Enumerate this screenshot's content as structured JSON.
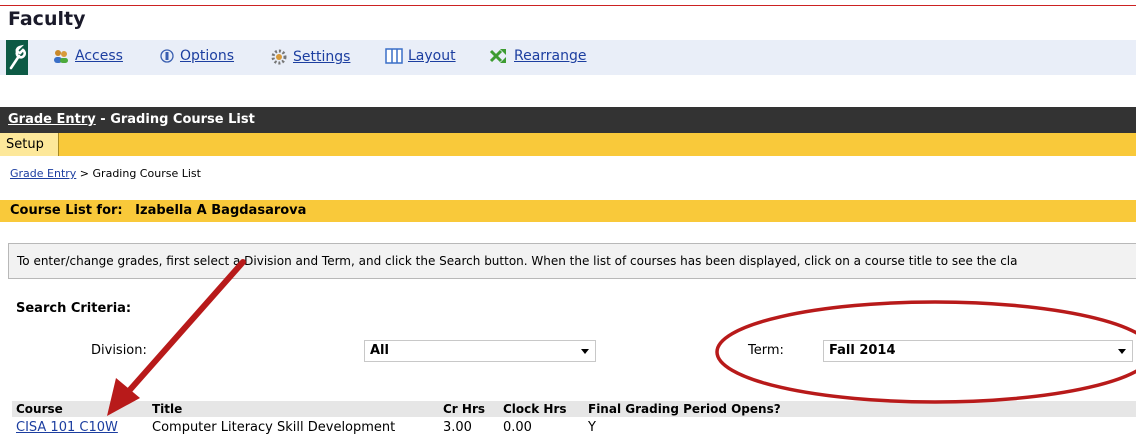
{
  "page": {
    "title": "Faculty"
  },
  "toolbar": {
    "items": [
      {
        "label": "Access",
        "icon": "users-icon"
      },
      {
        "label": "Options",
        "icon": "options-icon"
      },
      {
        "label": "Settings",
        "icon": "gear-icon"
      },
      {
        "label": "Layout",
        "icon": "layout-icon"
      },
      {
        "label": "Rearrange",
        "icon": "arrows-icon"
      }
    ]
  },
  "header": {
    "link": "Grade Entry",
    "separator": " - ",
    "title": "Grading Course List"
  },
  "tabs": {
    "setup": "Setup"
  },
  "breadcrumb": {
    "link": "Grade Entry",
    "separator": " > ",
    "current": "Grading Course List"
  },
  "course_list": {
    "label": "Course List for:",
    "name": "Izabella A Bagdasarova"
  },
  "info": {
    "text": "To enter/change grades, first select a Division and Term, and click the Search button. When the list of courses has been displayed, click on a course title to see the cla"
  },
  "search": {
    "title": "Search Criteria:",
    "division_label": "Division:",
    "division_value": "All",
    "term_label": "Term:",
    "term_value": "Fall 2014"
  },
  "table": {
    "headers": [
      "Course",
      "Title",
      "Cr Hrs",
      "Clock Hrs",
      "Final Grading Period Opens?"
    ],
    "rows": [
      [
        "CISA 101 C10W",
        "Computer Literacy Skill Development",
        "3.00",
        "0.00",
        "Y"
      ]
    ]
  },
  "colors": {
    "accent_yellow": "#f9c93a",
    "header_dark": "#333333",
    "link_blue": "#1c3ea0",
    "annotation_red": "#b81a1a"
  }
}
